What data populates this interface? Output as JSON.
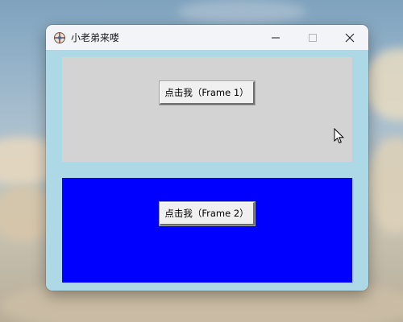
{
  "window": {
    "title": "小老弟来喽",
    "controls": {
      "minimize_icon": "minimize-icon",
      "maximize_icon": "maximize-icon",
      "close_icon": "close-icon"
    }
  },
  "frames": [
    {
      "background": "#d3d3d3",
      "button_label": "点击我（Frame 1）"
    },
    {
      "background": "#0000ff",
      "button_label": "点击我（Frame 2）"
    }
  ],
  "colors": {
    "client_background": "#add8e6",
    "titlebar": "#f3f4f8"
  }
}
